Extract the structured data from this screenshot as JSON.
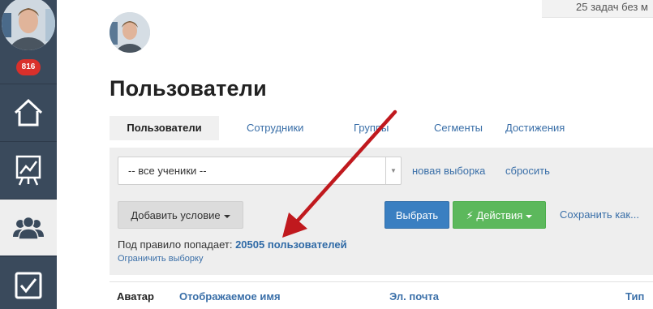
{
  "sidebar": {
    "badge": "816",
    "items": [
      {
        "icon": "home-icon"
      },
      {
        "icon": "chart-board-icon"
      },
      {
        "icon": "users-icon",
        "active": true
      },
      {
        "icon": "checkbox-icon"
      }
    ]
  },
  "header": {
    "tasks_text": "25 задач без м"
  },
  "page": {
    "title": "Пользователи"
  },
  "tabs": [
    {
      "label": "Пользователи",
      "active": true
    },
    {
      "label": "Сотрудники"
    },
    {
      "label": "Группы"
    },
    {
      "label": "Сегменты"
    },
    {
      "label": "Достижения"
    }
  ],
  "filter": {
    "select_value": "-- все ученики --",
    "new_selection_link": "новая выборка",
    "reset_link": "сбросить",
    "add_condition_label": "Добавить условие",
    "select_button_label": "Выбрать",
    "actions_button_label": "Действия",
    "save_as_link": "Сохранить как...",
    "rule_prefix": "Под правило попадает:",
    "rule_count": "20505 пользователей",
    "limit_link": "Ограничить выборку"
  },
  "table": {
    "columns": [
      "Аватар",
      "Отображаемое имя",
      "Эл. почта",
      "Тип"
    ]
  },
  "colors": {
    "sidebar_bg": "#3a4a5c",
    "badge": "#d9302b",
    "link": "#3a6fa8",
    "primary": "#3a7fc1",
    "success": "#5cb85c",
    "annotation_arrow": "#c0191e"
  }
}
